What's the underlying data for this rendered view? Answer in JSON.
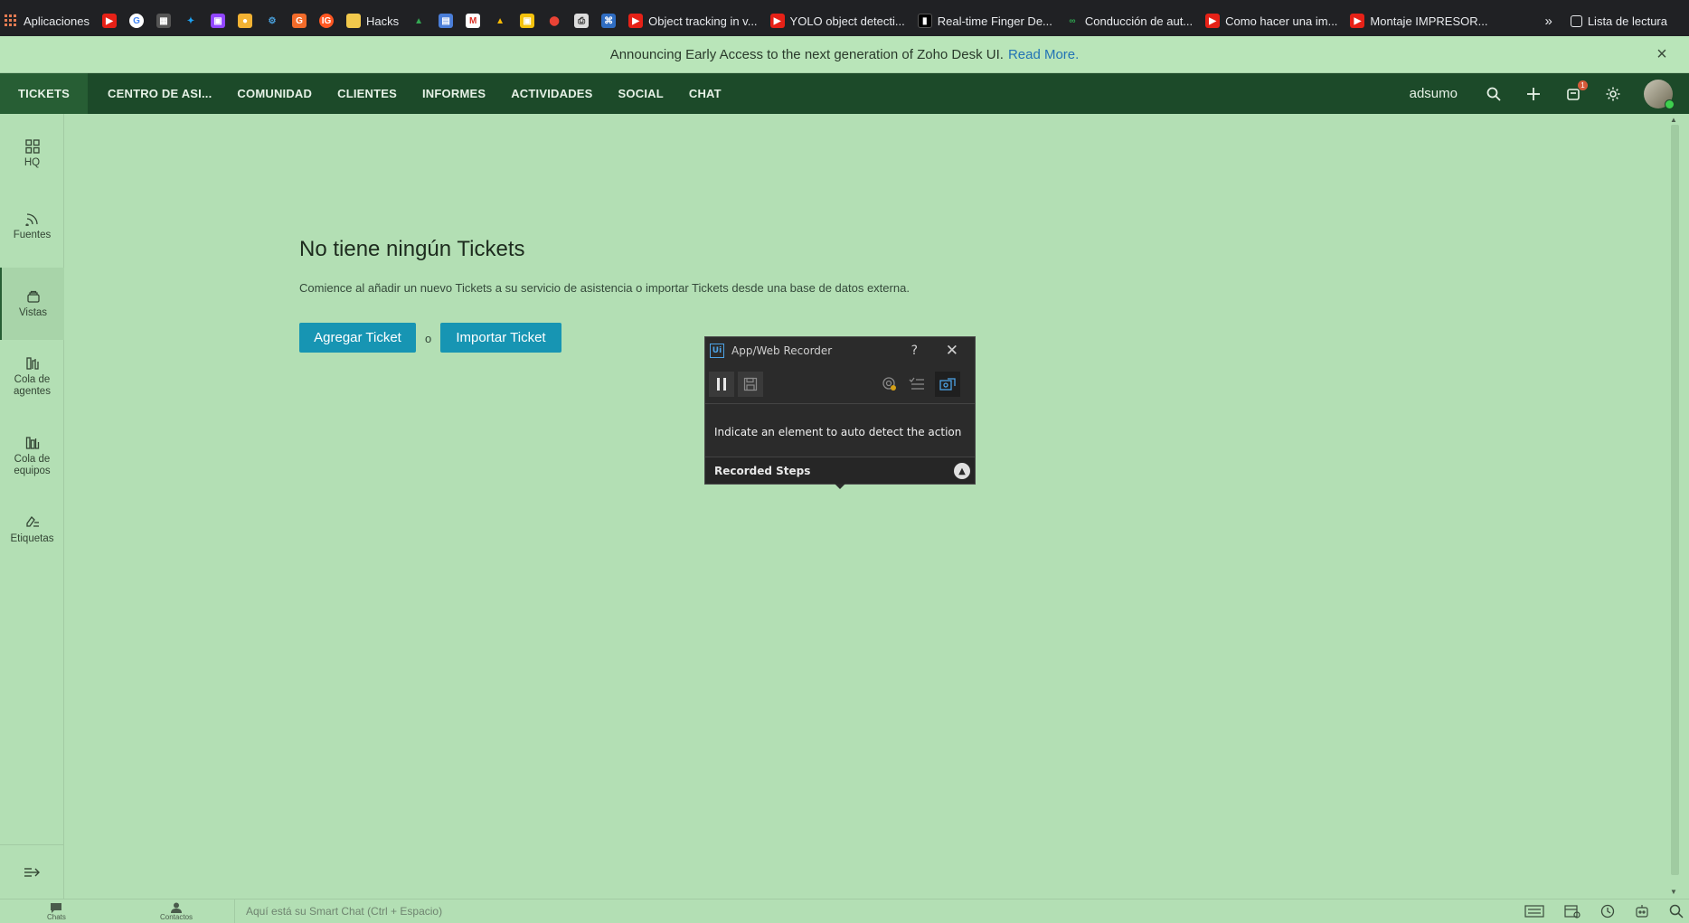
{
  "bookmarks": {
    "apps_label": "Aplicaciones",
    "hacks_label": "Hacks",
    "items": [
      {
        "label": "Object tracking in v..."
      },
      {
        "label": "YOLO object detecti..."
      },
      {
        "label": "Real-time Finger De..."
      },
      {
        "label": "Conducción de aut..."
      },
      {
        "label": "Como hacer una im..."
      },
      {
        "label": "Montaje IMPRESOR..."
      }
    ],
    "overflow": "»",
    "reading_list": "Lista de lectura"
  },
  "announcement": {
    "text": "Announcing Early Access to the next generation of Zoho Desk UI.",
    "link": "Read More."
  },
  "nav": {
    "tabs": [
      "TICKETS",
      "CENTRO DE ASI...",
      "COMUNIDAD",
      "CLIENTES",
      "INFORMES",
      "ACTIVIDADES",
      "SOCIAL",
      "CHAT"
    ],
    "user": "adsumo",
    "notification_count": "1"
  },
  "sidebar": {
    "items": [
      {
        "label": "HQ"
      },
      {
        "label": "Fuentes"
      },
      {
        "label": "Vistas"
      },
      {
        "label": "Cola de agentes"
      },
      {
        "label": "Cola de equipos"
      },
      {
        "label": "Etiquetas"
      }
    ]
  },
  "empty_state": {
    "title": "No tiene ningún Tickets",
    "description": "Comience al añadir un nuevo Tickets a su servicio de asistencia o importar Tickets desde una base de datos externa.",
    "add_button": "Agregar Ticket",
    "separator": "o",
    "import_button": "Importar Ticket"
  },
  "recorder": {
    "logo": "Ui",
    "title": "App/Web Recorder",
    "help": "?",
    "message": "Indicate an element to auto detect the action",
    "steps_label": "Recorded Steps"
  },
  "bottombar": {
    "chats": "Chats",
    "contacts": "Contactos",
    "smart_chat_placeholder": "Aquí está su Smart Chat (Ctrl + Espacio)"
  },
  "colors": {
    "nav_bg": "#1c4a29",
    "accent_button": "#1795b3",
    "page_bg": "#b3dfb4"
  }
}
